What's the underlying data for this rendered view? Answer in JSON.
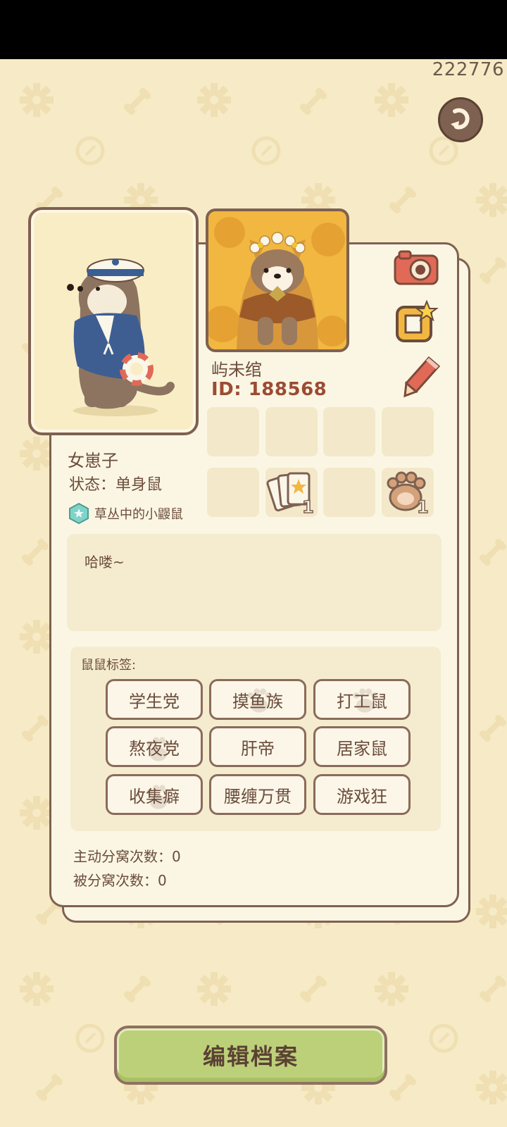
{
  "header": {
    "number": "222776"
  },
  "user": {
    "name": "屿未绾",
    "id": "ID: 188568",
    "nickname": "女崽子",
    "status": "状态：单身鼠",
    "title": "草丛中的小鼹鼠",
    "bio": "哈喽~"
  },
  "slots": {
    "cards_count": "1",
    "paw_count": "1"
  },
  "tags": {
    "title": "鼠鼠标签:",
    "items": [
      "学生党",
      "摸鱼族",
      "打工鼠",
      "熬夜党",
      "肝帝",
      "居家鼠",
      "收集癖",
      "腰缠万贯",
      "游戏狂"
    ]
  },
  "stats": {
    "active": "主动分窝次数：0",
    "passive": "被分窝次数：0"
  },
  "actions": {
    "edit": "编辑档案"
  },
  "icons": [
    "back-icon",
    "camera-icon",
    "frame-star-icon",
    "pencil-icon",
    "cards-icon",
    "paw-icon",
    "gem-badge-icon"
  ],
  "colors": {
    "background": "#f6ebc6",
    "border": "#7e6151",
    "button": "#bcd07a",
    "id_text": "#9c4b33"
  }
}
